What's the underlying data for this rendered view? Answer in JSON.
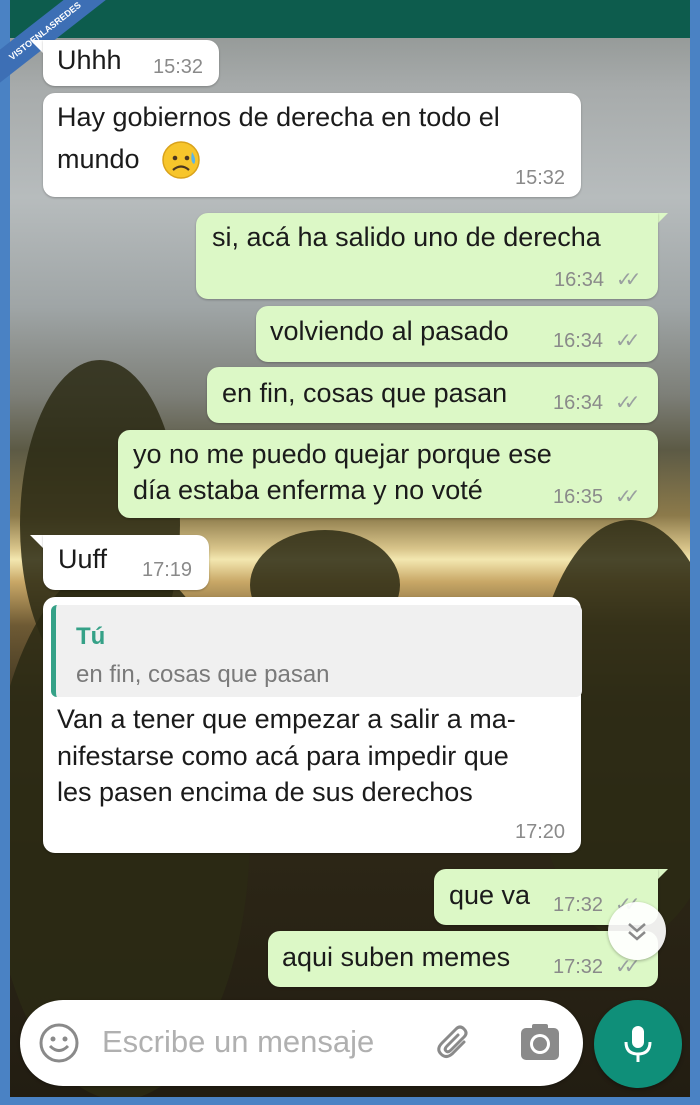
{
  "watermark": {
    "text": "VISTOENLASREDES",
    "sub": ".com"
  },
  "messages": [
    {
      "side": "in",
      "text": "Uhhh",
      "time": "15:32"
    },
    {
      "side": "in",
      "lines": [
        "Hay gobiernos de derecha en todo el",
        "mundo"
      ],
      "emoji": "sad-sweat-face",
      "time": "15:32"
    },
    {
      "side": "out",
      "text": "si, acá ha salido uno de derecha",
      "time": "16:34",
      "status": "read-ticks"
    },
    {
      "side": "out",
      "text": "volviendo al pasado",
      "time": "16:34",
      "status": "read-ticks"
    },
    {
      "side": "out",
      "text": "en fin, cosas que pasan",
      "time": "16:34",
      "status": "read-ticks"
    },
    {
      "side": "out",
      "lines": [
        "yo no me puedo quejar porque ese",
        "día estaba enferma y no voté"
      ],
      "time": "16:35",
      "status": "read-ticks"
    },
    {
      "side": "in",
      "text": "Uuff",
      "time": "17:19"
    },
    {
      "side": "in",
      "quote": {
        "author": "Tú",
        "text": "en fin, cosas que pasan"
      },
      "lines": [
        "Van a tener que empezar a salir a ma-",
        "nifestarse como acá para impedir que",
        "les pasen encima de sus derechos"
      ],
      "time": "17:20"
    },
    {
      "side": "out",
      "text": "que va",
      "time": "17:32",
      "status": "read-ticks"
    },
    {
      "side": "out",
      "text": "aqui suben memes",
      "time": "17:32",
      "status": "read-ticks"
    }
  ],
  "composer": {
    "placeholder": "Escribe un mensaje",
    "emoji_icon": "smiley-icon",
    "attach_icon": "paperclip-icon",
    "camera_icon": "camera-icon",
    "mic_icon": "mic-icon"
  },
  "colors": {
    "incoming": "#ffffff",
    "outgoing": "#dcf8c6",
    "accent": "#35a187",
    "header": "#0d5c4d",
    "mic": "#0f8f79"
  }
}
